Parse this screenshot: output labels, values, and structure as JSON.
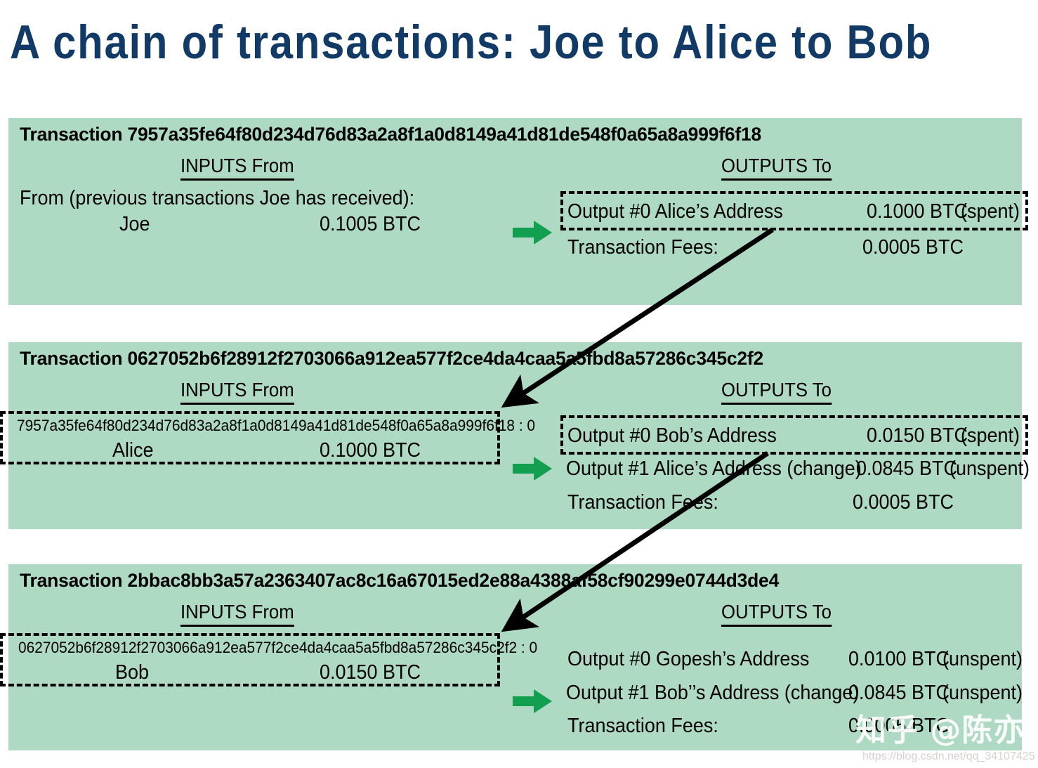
{
  "title": "A chain of transactions:  Joe to Alice to Bob",
  "colors": {
    "title": "#123a66",
    "panel_bg": "#aed9c2",
    "arrow_green": "#12a050",
    "text": "#000000"
  },
  "labels": {
    "inputs": "INPUTS From",
    "outputs": "OUTPUTS To",
    "transaction_fees": "Transaction Fees:"
  },
  "transactions": [
    {
      "heading": "Transaction 7957a35fe64f80d234d76d83a2a8f1a0d8149a41d81de548f0a65a8a999f6f18",
      "hash": "7957a35fe64f80d234d76d83a2a8f1a0d8149a41d81de548f0a65a8a999f6f18",
      "inputs_note": "From (previous transactions Joe has received):",
      "inputs": [
        {
          "ref": "",
          "name": "Joe",
          "amount": "0.1005 BTC"
        }
      ],
      "outputs": [
        {
          "label": "Output #0 Alice’s Address",
          "amount": "0.1000 BTC",
          "status": "(spent)"
        }
      ],
      "fees": "0.0005 BTC"
    },
    {
      "heading": "Transaction 0627052b6f28912f2703066a912ea577f2ce4da4caa5a5fbd8a57286c345c2f2",
      "hash": "0627052b6f28912f2703066a912ea577f2ce4da4caa5a5fbd8a57286c345c2f2",
      "inputs_note": "",
      "inputs": [
        {
          "ref": "7957a35fe64f80d234d76d83a2a8f1a0d8149a41d81de548f0a65a8a999f6f18 : 0",
          "name": "Alice",
          "amount": "0.1000 BTC"
        }
      ],
      "outputs": [
        {
          "label": "Output #0 Bob’s Address",
          "amount": "0.0150 BTC",
          "status": "(spent)"
        },
        {
          "label": "Output #1 Alice’s Address (change)",
          "amount": "0.0845 BTC",
          "status": "(unspent)"
        }
      ],
      "fees": "0.0005 BTC"
    },
    {
      "heading": "Transaction 2bbac8bb3a57a2363407ac8c16a67015ed2e88a4388af58cf90299e0744d3de4",
      "hash": "2bbac8bb3a57a2363407ac8c16a67015ed2e88a4388af58cf90299e0744d3de4",
      "inputs_note": "",
      "inputs": [
        {
          "ref": "0627052b6f28912f2703066a912ea577f2ce4da4caa5a5fbd8a57286c345c2f2 : 0",
          "name": "Bob",
          "amount": "0.0150 BTC"
        }
      ],
      "outputs": [
        {
          "label": "Output #0 Gopesh’s Address",
          "amount": "0.0100 BTC",
          "status": "(unspent)"
        },
        {
          "label": "Output #1 Bob’’s Address (change)",
          "amount": "0.0845 BTC",
          "status": "(unspent)"
        }
      ],
      "fees": "0.0005 BTC"
    }
  ],
  "watermark": {
    "zhihu": "知乎 @陈亦新",
    "url": "https://blog.csdn.net/qq_34107425"
  }
}
